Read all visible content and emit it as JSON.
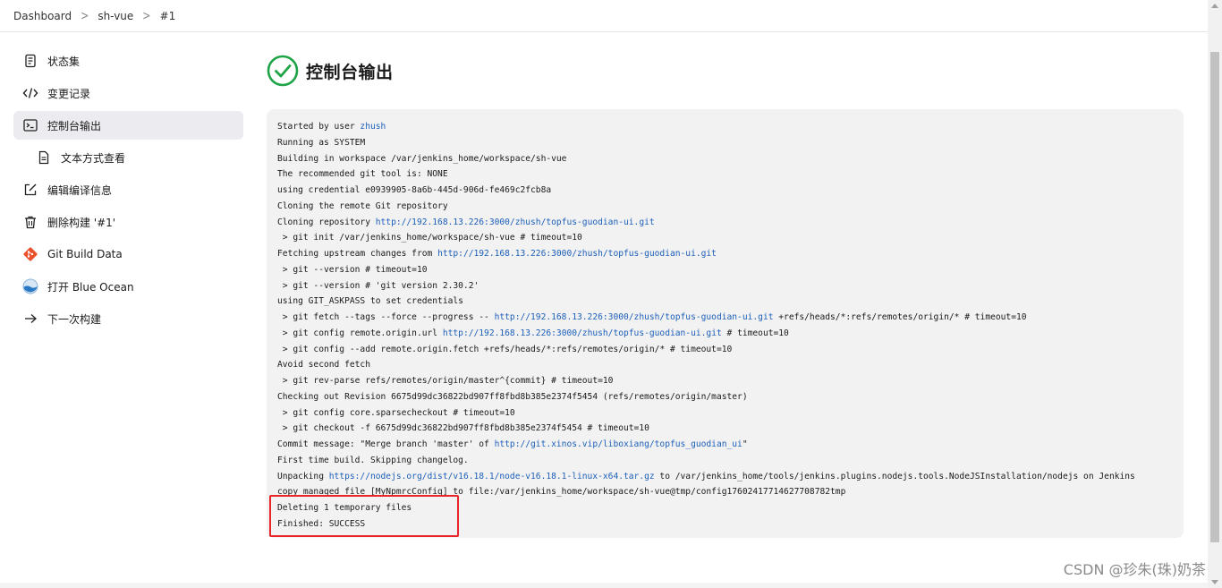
{
  "breadcrumb": [
    {
      "label": "Dashboard"
    },
    {
      "label": "sh-vue"
    },
    {
      "label": "#1"
    }
  ],
  "sidebar": {
    "items": [
      {
        "label": "状态集",
        "icon": "document-icon"
      },
      {
        "label": "变更记录",
        "icon": "code-icon"
      },
      {
        "label": "控制台输出",
        "icon": "terminal-icon",
        "active": true
      },
      {
        "label": "文本方式查看",
        "icon": "file-text-icon",
        "sub": true
      },
      {
        "label": "编辑编译信息",
        "icon": "edit-icon"
      },
      {
        "label": "删除构建 '#1'",
        "icon": "trash-icon"
      },
      {
        "label": "Git Build Data",
        "icon": "git-icon"
      },
      {
        "label": "打开 Blue Ocean",
        "icon": "blue-ocean-icon"
      },
      {
        "label": "下一次构建",
        "icon": "arrow-right-icon"
      }
    ]
  },
  "main": {
    "title": "控制台输出",
    "status_icon": "success-check-icon",
    "status_color": "#1ea446"
  },
  "console": {
    "lines": [
      [
        {
          "t": "Started by user "
        },
        {
          "t": "zhush",
          "link": true
        }
      ],
      [
        {
          "t": "Running as SYSTEM"
        }
      ],
      [
        {
          "t": "Building in workspace /var/jenkins_home/workspace/sh-vue"
        }
      ],
      [
        {
          "t": "The recommended git tool is: NONE"
        }
      ],
      [
        {
          "t": "using credential e0939905-8a6b-445d-906d-fe469c2fcb8a"
        }
      ],
      [
        {
          "t": "Cloning the remote Git repository"
        }
      ],
      [
        {
          "t": "Cloning repository "
        },
        {
          "t": "http://192.168.13.226:3000/zhush/topfus-guodian-ui.git",
          "link": true
        }
      ],
      [
        {
          "t": " > git init /var/jenkins_home/workspace/sh-vue # timeout=10"
        }
      ],
      [
        {
          "t": "Fetching upstream changes from "
        },
        {
          "t": "http://192.168.13.226:3000/zhush/topfus-guodian-ui.git",
          "link": true
        }
      ],
      [
        {
          "t": " > git --version # timeout=10"
        }
      ],
      [
        {
          "t": " > git --version # 'git version 2.30.2'"
        }
      ],
      [
        {
          "t": "using GIT_ASKPASS to set credentials"
        }
      ],
      [
        {
          "t": " > git fetch --tags --force --progress -- "
        },
        {
          "t": "http://192.168.13.226:3000/zhush/topfus-guodian-ui.git",
          "link": true
        },
        {
          "t": " +refs/heads/*:refs/remotes/origin/* # timeout=10"
        }
      ],
      [
        {
          "t": " > git config remote.origin.url "
        },
        {
          "t": "http://192.168.13.226:3000/zhush/topfus-guodian-ui.git",
          "link": true
        },
        {
          "t": " # timeout=10"
        }
      ],
      [
        {
          "t": " > git config --add remote.origin.fetch +refs/heads/*:refs/remotes/origin/* # timeout=10"
        }
      ],
      [
        {
          "t": "Avoid second fetch"
        }
      ],
      [
        {
          "t": " > git rev-parse refs/remotes/origin/master^{commit} # timeout=10"
        }
      ],
      [
        {
          "t": "Checking out Revision 6675d99dc36822bd907ff8fbd8b385e2374f5454 (refs/remotes/origin/master)"
        }
      ],
      [
        {
          "t": " > git config core.sparsecheckout # timeout=10"
        }
      ],
      [
        {
          "t": " > git checkout -f 6675d99dc36822bd907ff8fbd8b385e2374f5454 # timeout=10"
        }
      ],
      [
        {
          "t": "Commit message: \"Merge branch 'master' of "
        },
        {
          "t": "http://git.xinos.vip/liboxiang/topfus_guodian_ui",
          "link": true
        },
        {
          "t": "\""
        }
      ],
      [
        {
          "t": "First time build. Skipping changelog."
        }
      ],
      [
        {
          "t": "Unpacking "
        },
        {
          "t": "https://nodejs.org/dist/v16.18.1/node-v16.18.1-linux-x64.tar.gz",
          "link": true
        },
        {
          "t": " to /var/jenkins_home/tools/jenkins.plugins.nodejs.tools.NodeJSInstallation/nodejs on Jenkins"
        }
      ],
      [
        {
          "t": "copy managed file [MyNpmrcConfig] to file:/var/jenkins_home/workspace/sh-vue@tmp/config17602417714627708782tmp"
        }
      ],
      [
        {
          "t": "Deleting 1 temporary files"
        }
      ],
      [
        {
          "t": "Finished: SUCCESS"
        }
      ]
    ]
  },
  "watermark": "CSDN @珍朱(珠)奶茶",
  "colors": {
    "link": "#1c5fb8",
    "highlight_border": "#e8262a",
    "success": "#1ea446",
    "console_bg": "#f2f2f3"
  }
}
